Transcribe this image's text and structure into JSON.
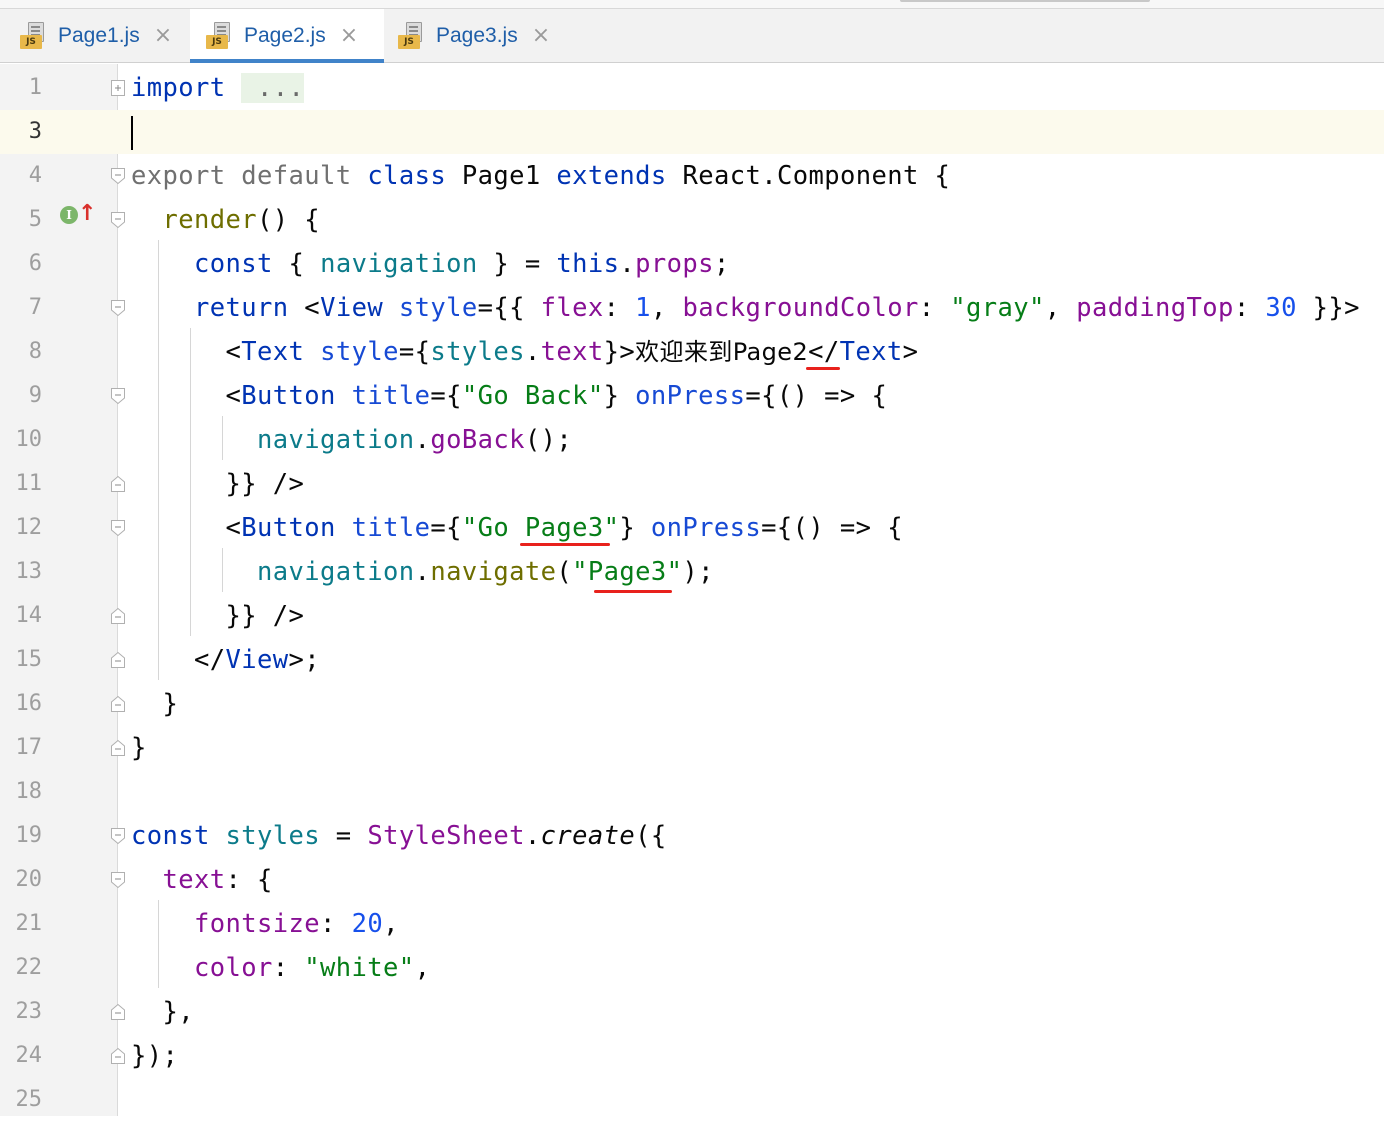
{
  "tabs": [
    {
      "label": "Page1.js",
      "badge": "JS",
      "close": "×"
    },
    {
      "label": "Page2.js",
      "badge": "JS",
      "close": "×"
    },
    {
      "label": "Page3.js",
      "badge": "JS",
      "close": "×"
    }
  ],
  "active_tab": "Page2.js",
  "gutter": {
    "line_numbers": [
      "1",
      "3",
      "4",
      "5",
      "6",
      "7",
      "8",
      "9",
      "10",
      "11",
      "12",
      "13",
      "14",
      "15",
      "16",
      "17",
      "18",
      "19",
      "20",
      "21",
      "22",
      "23",
      "24",
      "25"
    ],
    "implements_icon": "I",
    "implements_arrow": "↑"
  },
  "code": {
    "line1": {
      "import": "import",
      "folded": " ..."
    },
    "line4": {
      "export": "export",
      "default": "default",
      "class": "class",
      "name": "Page1",
      "extends": "extends",
      "base": "React.Component",
      "brace": "{"
    },
    "line5": {
      "render": "render",
      "rest": "() {"
    },
    "line6": {
      "const": "const",
      "open": "{ ",
      "var": "navigation",
      "close": " } = ",
      "this": "this",
      "dot": ".",
      "props": "props",
      "semi": ";"
    },
    "line7": {
      "return": "return",
      "lt": "<",
      "tag": "View",
      "attr": "style",
      "eq": "={{ ",
      "flex": "flex",
      "c1": ": ",
      "n1": "1",
      "comma1": ", ",
      "bg": "backgroundColor",
      "c2": ": ",
      "gray": "\"gray\"",
      "comma2": ", ",
      "pt": "paddingTop",
      "c3": ": ",
      "n2": "30",
      "end": " }}>"
    },
    "line8": {
      "lt": "<",
      "tag": "Text",
      "attr": "style",
      "eq": "={",
      "obj": "styles",
      "dot": ".",
      "prop": "text",
      "gt": "}>",
      "content": "欢迎来到Page2",
      "close_lt": "</",
      "close_tag": "Text",
      "close_gt": ">"
    },
    "line9": {
      "lt": "<",
      "tag": "Button",
      "attr": "title",
      "eq": "={",
      "str": "\"Go Back\"",
      "sep": "} ",
      "attr2": "onPress",
      "rest": "={() => {"
    },
    "line10": {
      "var": "navigation",
      "dot": ".",
      "fn": "goBack",
      "rest": "();"
    },
    "line11": {
      "text": "}} />"
    },
    "line12": {
      "lt": "<",
      "tag": "Button",
      "attr": "title",
      "eq": "={",
      "str": "\"Go Page3\"",
      "sep": "} ",
      "attr2": "onPress",
      "rest": "={() => {"
    },
    "line13": {
      "var": "navigation",
      "dot": ".",
      "fn": "navigate",
      "open": "(",
      "str": "\"Page3\"",
      "close": ");"
    },
    "line14": {
      "text": "}} />"
    },
    "line15": {
      "lt": "</",
      "tag": "View",
      "rest": ">;"
    },
    "line16": {
      "text": "}"
    },
    "line17": {
      "text": "}"
    },
    "line19": {
      "const": "const",
      "var": "styles",
      "eq": " = ",
      "cls": "StyleSheet",
      "dot": ".",
      "fn": "create",
      "rest": "({"
    },
    "line20": {
      "prop": "text",
      "rest": ": {"
    },
    "line21": {
      "prop": "fontsize",
      "colon": ": ",
      "num": "20",
      "comma": ","
    },
    "line22": {
      "prop": "color",
      "colon": ": ",
      "str": "\"white\"",
      "comma": ","
    },
    "line23": {
      "text": "},"
    },
    "line24": {
      "text": "});"
    }
  },
  "colors": {
    "keyword": "#0033b3",
    "string": "#067d17",
    "number": "#1750eb",
    "field": "#871094",
    "function": "#6e6e00",
    "underline_mark": "#e8211c",
    "active_tab_accent": "#4083c9"
  }
}
